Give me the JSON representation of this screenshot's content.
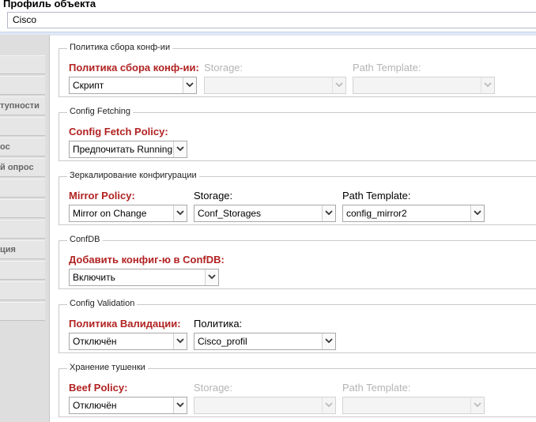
{
  "header": {
    "title": "Профиль объекта"
  },
  "name_field": {
    "value": "Cisco"
  },
  "sidebar": {
    "items": [
      "",
      "",
      "",
      "тупности",
      "",
      "ос",
      "й опрос",
      "",
      "",
      "",
      "",
      "ция",
      "",
      "",
      ""
    ]
  },
  "sections": {
    "config_policy": {
      "legend": "Политика сбора конф-ии",
      "policy_label": "Политика сбора конф-ии:",
      "policy_value": "Скрипт",
      "storage_label": "Storage:",
      "storage_value": "",
      "path_label": "Path Template:",
      "path_value": ""
    },
    "config_fetching": {
      "legend": "Config Fetching",
      "policy_label": "Config Fetch Policy:",
      "policy_value": "Предпочитать Running"
    },
    "mirroring": {
      "legend": "Зеркалирование конфигурации",
      "policy_label": "Mirror Policy:",
      "policy_value": "Mirror on Change",
      "storage_label": "Storage:",
      "storage_value": "Conf_Storages",
      "path_label": "Path Template:",
      "path_value": "config_mirror2"
    },
    "confdb": {
      "legend": "ConfDB",
      "add_label": "Добавить конфиг-ю в ConfDB:",
      "add_value": "Включить"
    },
    "validation": {
      "legend": "Config Validation",
      "policy_label": "Политика Валидации:",
      "policy_value": "Отключён",
      "profile_label": "Политика:",
      "profile_value": "Cisco_profil"
    },
    "beef": {
      "legend": "Хранение тушенки",
      "policy_label": "Beef Policy:",
      "policy_value": "Отключён",
      "storage_label": "Storage:",
      "storage_value": "",
      "path_label": "Path Template:",
      "path_value": ""
    }
  },
  "icons": {
    "dropdown": "chevron-down-icon"
  },
  "colors": {
    "required_label": "#b22222",
    "disabled_label": "#b4b4b4",
    "sidebar": "#dedede",
    "border": "#c9c9c9"
  }
}
